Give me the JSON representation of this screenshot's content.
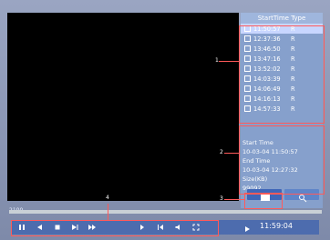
{
  "columns": {
    "start_time": "StartTime",
    "type": "Type"
  },
  "records": [
    {
      "time": "11:50:57",
      "type": "R",
      "checked": true
    },
    {
      "time": "12:37:36",
      "type": "R",
      "checked": true
    },
    {
      "time": "13:46:50",
      "type": "R",
      "checked": false
    },
    {
      "time": "13:47:16",
      "type": "R",
      "checked": false
    },
    {
      "time": "13:52:02",
      "type": "R",
      "checked": false
    },
    {
      "time": "14:03:39",
      "type": "R",
      "checked": false
    },
    {
      "time": "14:06:49",
      "type": "R",
      "checked": false
    },
    {
      "time": "14:16:13",
      "type": "R",
      "checked": false
    },
    {
      "time": "14:57:33",
      "type": "R",
      "checked": false
    }
  ],
  "info": {
    "start_label": "Start Time",
    "start_value": "10-03-04 11:50:57",
    "end_label": "End Time",
    "end_value": "10-03-04 12:27:32",
    "size_label": "Size(KB)",
    "size_value": "99092"
  },
  "timeline": {
    "label": "2100"
  },
  "status": {
    "clock": "11:59:04"
  },
  "callouts": [
    "1",
    "2",
    "3",
    "4"
  ]
}
